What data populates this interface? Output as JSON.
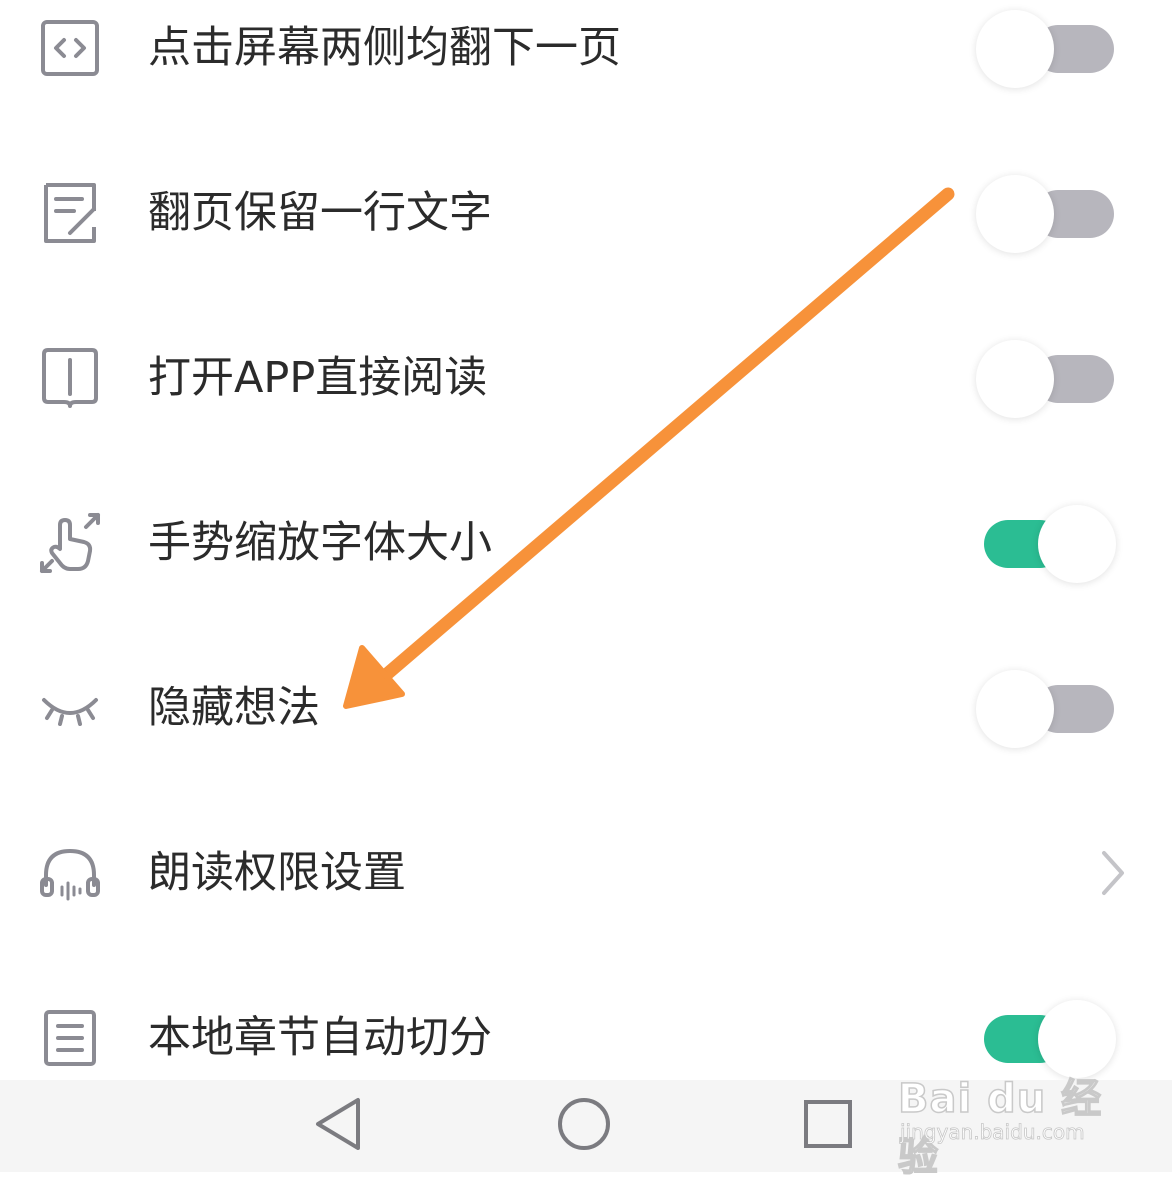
{
  "settings": {
    "items": [
      {
        "label": "点击屏幕两侧均翻下一页",
        "icon": "page-turn-icon",
        "control": "toggle",
        "on": false
      },
      {
        "label": "翻页保留一行文字",
        "icon": "note-edit-icon",
        "control": "toggle",
        "on": false
      },
      {
        "label": "打开APP直接阅读",
        "icon": "open-book-icon",
        "control": "toggle",
        "on": false
      },
      {
        "label": "手势缩放字体大小",
        "icon": "pinch-gesture-icon",
        "control": "toggle",
        "on": true
      },
      {
        "label": "隐藏想法",
        "icon": "closed-eye-icon",
        "control": "toggle",
        "on": false
      },
      {
        "label": "朗读权限设置",
        "icon": "headphones-icon",
        "control": "chevron"
      },
      {
        "label": "本地章节自动切分",
        "icon": "list-document-icon",
        "control": "toggle",
        "on": true
      }
    ]
  },
  "navbar": {
    "buttons": [
      "back-triangle-icon",
      "home-circle-icon",
      "recents-square-icon"
    ]
  },
  "watermark": {
    "brand": "Bai du 经验",
    "url": "jingyan.baidu.com"
  },
  "colors": {
    "toggle_on": "#2bbd93",
    "toggle_off": "#b7b6bd",
    "annotation_arrow": "#f7923a",
    "icon_stroke": "#8b8b93"
  }
}
